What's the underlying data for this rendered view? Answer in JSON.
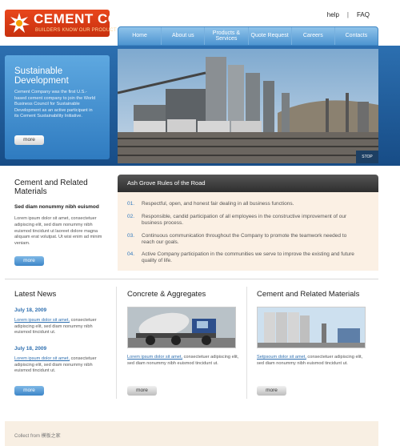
{
  "brand": {
    "name": "CEMENT CO.",
    "tagline": "BUILDERS KNOW OUR PRODUCT",
    "primary_color": "#d93a14",
    "accent_color": "#3f86c4"
  },
  "toplinks": {
    "help": "help",
    "separator": "|",
    "faq": "FAQ"
  },
  "nav": {
    "home": "Home",
    "about": "About us",
    "products": "Products & Services",
    "quote": "Quote Request",
    "careers": "Careers",
    "contacts": "Contacts"
  },
  "hero": {
    "title": "Sustainable Development",
    "text": "Cement Company was the first U.S.-based cement company to join the World Business Council for Sustainable Development as an active participant in its Cement Sustainability Initiative.",
    "more": "more",
    "stop": "STOP"
  },
  "intro": {
    "title": "Cement and Related Materials",
    "subtitle": "Sed diam nonummy nibh euismod",
    "text": "Lorem ipsum dolor sit amet, consectetuer adipiscing elit, sed diam nonummy nibh euismod tincidunt ut laoreet dolore magna aliquam erat volutpat. Ut wisi enim ad minim veniam.",
    "more": "more"
  },
  "rules": {
    "title": "Ash Grove Rules of the Road",
    "items": [
      {
        "num": "01.",
        "text": "Respectful, open, and honest fair dealing in all business functions."
      },
      {
        "num": "02.",
        "text": "Responsible, candid participation of all employees in the constructive improvement of our business process."
      },
      {
        "num": "03.",
        "text": "Continuous communication throughout the Company to promote the teamwork needed to reach our goals."
      },
      {
        "num": "04.",
        "text": "Active Company participation in the communities we serve to improve the existing and future quality of life."
      }
    ]
  },
  "news": {
    "title": "Latest News",
    "items": [
      {
        "date": "July 18, 2009",
        "link": "Lorem ipsum dolor sit amet,",
        "text": " consectetuer adipiscing elit, sed diam nonummy nibh euismod tincidunt ut."
      },
      {
        "date": "July 18, 2009",
        "link": "Lorem ipsum dolor sit amet,",
        "text": " consectetuer adipiscing elit, sed diam nonummy nibh euismod tincidunt ut."
      }
    ],
    "more": "more"
  },
  "concrete": {
    "title": "Concrete & Aggregates",
    "link": "Lorem ipsum dolor sit amet,",
    "text": " consectetuer adipiscing elit, sed diam nonummy nibh euismod tincidunt ut.",
    "more": "more"
  },
  "cement": {
    "title": "Cement and Related Materials",
    "link": "Setpsoum dolor sit amet,",
    "text": " consectetuer adipiscing elit, sed diam nonummy nibh euismod tincidunt ut.",
    "more": "more"
  },
  "footer": {
    "text": "Collect from 模板之家"
  }
}
